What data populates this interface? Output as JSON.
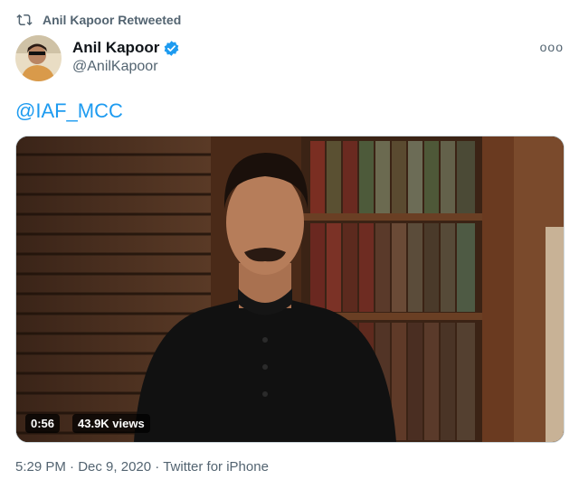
{
  "retweet": {
    "icon": "retweet-icon",
    "text": "Anil Kapoor Retweeted"
  },
  "author": {
    "name": "Anil Kapoor",
    "handle": "@AnilKapoor",
    "verified_icon": "verified-badge-icon"
  },
  "menu": {
    "icon": "more-icon"
  },
  "tweet": {
    "text": "@IAF_MCC"
  },
  "video": {
    "duration": "0:56",
    "views": "43.9K views"
  },
  "footer": {
    "time": "5:29 PM",
    "sep1": "·",
    "date": "Dec 9, 2020",
    "sep2": "·",
    "source": "Twitter for iPhone"
  },
  "colors": {
    "link": "#1d9bf0",
    "muted": "#536471",
    "verified": "#1d9bf0"
  }
}
